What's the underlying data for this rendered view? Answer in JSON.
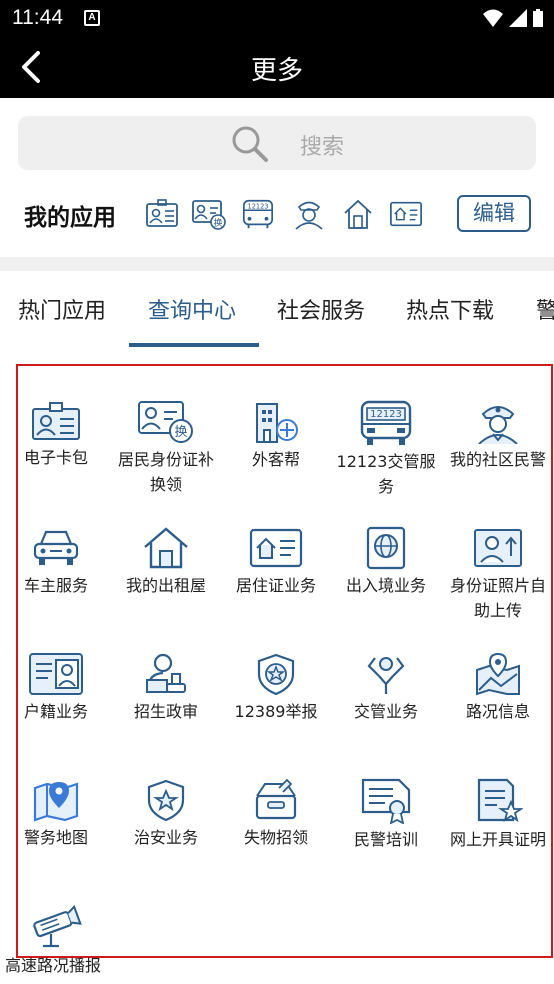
{
  "status_bar": {
    "time": "11:44",
    "notification_letter": "A"
  },
  "header": {
    "title": "更多"
  },
  "search": {
    "placeholder": "搜索"
  },
  "my_apps": {
    "title": "我的应用",
    "icons": [
      "id-card-icon",
      "id-renew-icon",
      "bus-12123-icon",
      "police-officer-icon",
      "house-icon",
      "residence-card-icon"
    ],
    "edit_label": "编辑"
  },
  "tabs": [
    {
      "label": "热门应用",
      "active": false
    },
    {
      "label": "查询中心",
      "active": true
    },
    {
      "label": "社会服务",
      "active": false
    },
    {
      "label": "热点下载",
      "active": false
    },
    {
      "label": "警",
      "active": false
    }
  ],
  "apps": [
    {
      "label": "电子卡包",
      "icon": "id-card-icon"
    },
    {
      "label": "居民身份证补换领",
      "icon": "id-renew-icon"
    },
    {
      "label": "外客帮",
      "icon": "building-icon"
    },
    {
      "label": "12123交管服务",
      "icon": "bus-12123-icon"
    },
    {
      "label": "我的社区民警",
      "icon": "police-officer-icon"
    },
    {
      "label": "车主服务",
      "icon": "car-icon"
    },
    {
      "label": "我的出租屋",
      "icon": "house-icon"
    },
    {
      "label": "居住证业务",
      "icon": "residence-card-icon"
    },
    {
      "label": "出入境业务",
      "icon": "globe-passport-icon"
    },
    {
      "label": "身份证照片自助上传",
      "icon": "photo-upload-icon"
    },
    {
      "label": "户籍业务",
      "icon": "household-register-icon"
    },
    {
      "label": "招生政审",
      "icon": "person-stamp-icon"
    },
    {
      "label": "12389举报",
      "icon": "shield-star-icon"
    },
    {
      "label": "交管业务",
      "icon": "traffic-police-icon"
    },
    {
      "label": "路况信息",
      "icon": "map-pin-icon"
    },
    {
      "label": "警务地图",
      "icon": "police-map-icon"
    },
    {
      "label": "治安业务",
      "icon": "security-shield-icon"
    },
    {
      "label": "失物招领",
      "icon": "lost-box-icon"
    },
    {
      "label": "民警培训",
      "icon": "certificate-icon"
    },
    {
      "label": "网上开具证明",
      "icon": "document-star-icon"
    },
    {
      "label": "高速路况播报",
      "icon": "highway-camera-icon"
    }
  ],
  "colors": {
    "primary": "#2d5d8a",
    "icon_blue": "#3a7bd5",
    "highlight_frame": "#d01919"
  }
}
